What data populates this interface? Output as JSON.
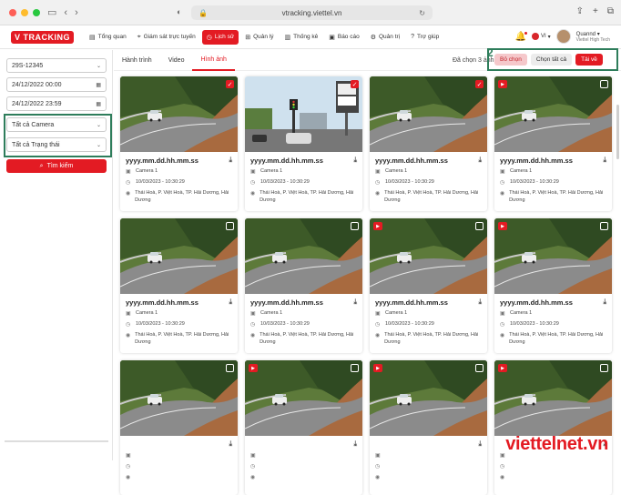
{
  "browser": {
    "url": "vtracking.viettel.vn",
    "nav_back": "‹",
    "nav_forward": "›",
    "sidebar_toggle": "▭",
    "shield": "◐",
    "lock": "🔒",
    "reload": "↻",
    "share": "⇪",
    "new_tab": "+",
    "tabs": "⧉"
  },
  "app": {
    "logo": "V TRACKING",
    "menu": [
      {
        "label": "Tổng quan",
        "icon": "▤"
      },
      {
        "label": "Giám sát trực tuyến",
        "icon": "⌖"
      },
      {
        "label": "Lịch sử",
        "icon": "◷"
      },
      {
        "label": "Quản lý",
        "icon": "⊞"
      },
      {
        "label": "Thống kê",
        "icon": "▥"
      },
      {
        "label": "Báo cáo",
        "icon": "▣"
      },
      {
        "label": "Quản trị",
        "icon": "⚙"
      },
      {
        "label": "Trợ giúp",
        "icon": "?"
      }
    ],
    "bell_icon": "🔔",
    "lang": "VI",
    "lang_caret": "▾",
    "user_name": "Quannd",
    "user_org": "Viettel High Tech",
    "user_caret": "▾"
  },
  "sidebar": {
    "plate": "29S-12345",
    "date_from": "24/12/2022 00:00",
    "date_to": "24/12/2022 23:59",
    "camera": "Tất cả Camera",
    "status": "Tất cả Trạng thái",
    "search_label": "Tìm kiếm",
    "search_icon": "⌕",
    "caret": "⌄",
    "calendar_icon": "▦"
  },
  "main": {
    "tabs": [
      {
        "label": "Hành trình"
      },
      {
        "label": "Video"
      },
      {
        "label": "Hình ảnh"
      }
    ],
    "selected_count": "Đã chọn 3 ảnh",
    "box_number": "2",
    "btn_deselect": "Bỏ chọn",
    "btn_select_all": "Chọn tất cả",
    "btn_download": "Tải về"
  },
  "cards": [
    {
      "title": "yyyy.mm.dd.hh.mm.ss",
      "camera": "Camera 1",
      "time": "10/03/2023 - 10:30:29",
      "address": "Thái Hoà, P. Việt Hoà, TP. Hải Dương, Hải Dương",
      "checked": true,
      "badge": false,
      "scene": "road"
    },
    {
      "title": "yyyy.mm.dd.hh.mm.ss",
      "camera": "Camera 1",
      "time": "10/03/2023 - 10:30:29",
      "address": "Thái Hoà, P. Việt Hoà, TP. Hải Dương, Hải Dương",
      "checked": true,
      "badge": false,
      "scene": "street"
    },
    {
      "title": "yyyy.mm.dd.hh.mm.ss",
      "camera": "Camera 1",
      "time": "10/03/2023 - 10:30:29",
      "address": "Thái Hoà, P. Việt Hoà, TP. Hải Dương, Hải Dương",
      "checked": true,
      "badge": false,
      "scene": "road"
    },
    {
      "title": "yyyy.mm.dd.hh.mm.ss",
      "camera": "Camera 1",
      "time": "10/03/2023 - 10:30:29",
      "address": "Thái Hoà, P. Việt Hoà, TP. Hải Dương, Hải Dương",
      "checked": false,
      "badge": true,
      "scene": "road"
    },
    {
      "title": "yyyy.mm.dd.hh.mm.ss",
      "camera": "Camera 1",
      "time": "10/03/2023 - 10:30:29",
      "address": "Thái Hoà, P. Việt Hoà, TP. Hải Dương, Hải Dương",
      "checked": false,
      "badge": false,
      "scene": "road"
    },
    {
      "title": "yyyy.mm.dd.hh.mm.ss",
      "camera": "Camera 1",
      "time": "10/03/2023 - 10:30:29",
      "address": "Thái Hoà, P. Việt Hoà, TP. Hải Dương, Hải Dương",
      "checked": false,
      "badge": false,
      "scene": "road"
    },
    {
      "title": "yyyy.mm.dd.hh.mm.ss",
      "camera": "Camera 1",
      "time": "10/03/2023 - 10:30:29",
      "address": "Thái Hoà, P. Việt Hoà, TP. Hải Dương, Hải Dương",
      "checked": false,
      "badge": true,
      "scene": "road"
    },
    {
      "title": "yyyy.mm.dd.hh.mm.ss",
      "camera": "Camera 1",
      "time": "10/03/2023 - 10:30:29",
      "address": "Thái Hoà, P. Việt Hoà, TP. Hải Dương, Hải Dương",
      "checked": false,
      "badge": true,
      "scene": "road"
    },
    {
      "title": "",
      "camera": "",
      "time": "",
      "address": "",
      "checked": false,
      "badge": false,
      "scene": "road"
    },
    {
      "title": "",
      "camera": "",
      "time": "",
      "address": "",
      "checked": false,
      "badge": true,
      "scene": "road"
    },
    {
      "title": "",
      "camera": "",
      "time": "",
      "address": "",
      "checked": false,
      "badge": true,
      "scene": "road"
    },
    {
      "title": "",
      "camera": "",
      "time": "",
      "address": "",
      "checked": false,
      "badge": true,
      "scene": "road"
    }
  ],
  "icons": {
    "download": "⤓",
    "camera": "▣",
    "clock": "◷",
    "pin": "◉",
    "check": "✓",
    "badge": "▶"
  },
  "watermark": "viettelnet.vn",
  "colors": {
    "accent": "#e31b23",
    "highlight_box": "#2e7d5b"
  }
}
